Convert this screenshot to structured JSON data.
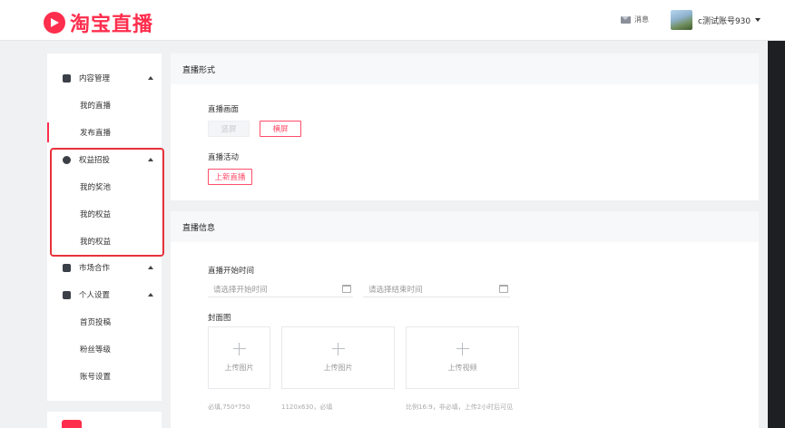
{
  "header": {
    "logo_text": "淘宝直播",
    "message_label": "消息",
    "username": "c测试账号930",
    "brand_color": "#ff2e4d"
  },
  "sidebar": {
    "sections": [
      {
        "label": "内容管理",
        "icon": "document-icon",
        "items": [
          "我的直播",
          "发布直播"
        ]
      },
      {
        "label": "权益招投",
        "icon": "cube-icon",
        "items": [
          "我的奖池",
          "我的权益",
          "我的权益"
        ]
      },
      {
        "label": "市场合作",
        "icon": "chat-icon",
        "items": []
      },
      {
        "label": "个人设置",
        "icon": "chat-icon",
        "items": [
          "首页投稿",
          "粉丝等级",
          "账号设置"
        ]
      }
    ],
    "active_item": "发布直播"
  },
  "live_form": {
    "title": "直播形式",
    "screen_label": "直播画面",
    "portrait": "竖屏",
    "landscape": "横屏",
    "activity_label": "直播活动",
    "activity_button": "上新直播"
  },
  "live_info": {
    "title": "直播信息",
    "start_time_label": "直播开始时间",
    "start_placeholder": "请选择开始时间",
    "end_placeholder": "请选择结束时间",
    "cover_label": "封面图",
    "uploads": [
      {
        "label": "上传图片",
        "hint": "必填,750*750"
      },
      {
        "label": "上传图片",
        "hint": "1120x630，必填"
      },
      {
        "label": "上传视频",
        "hint": "比例16:9，非必填，上传2小时后可见"
      }
    ]
  }
}
